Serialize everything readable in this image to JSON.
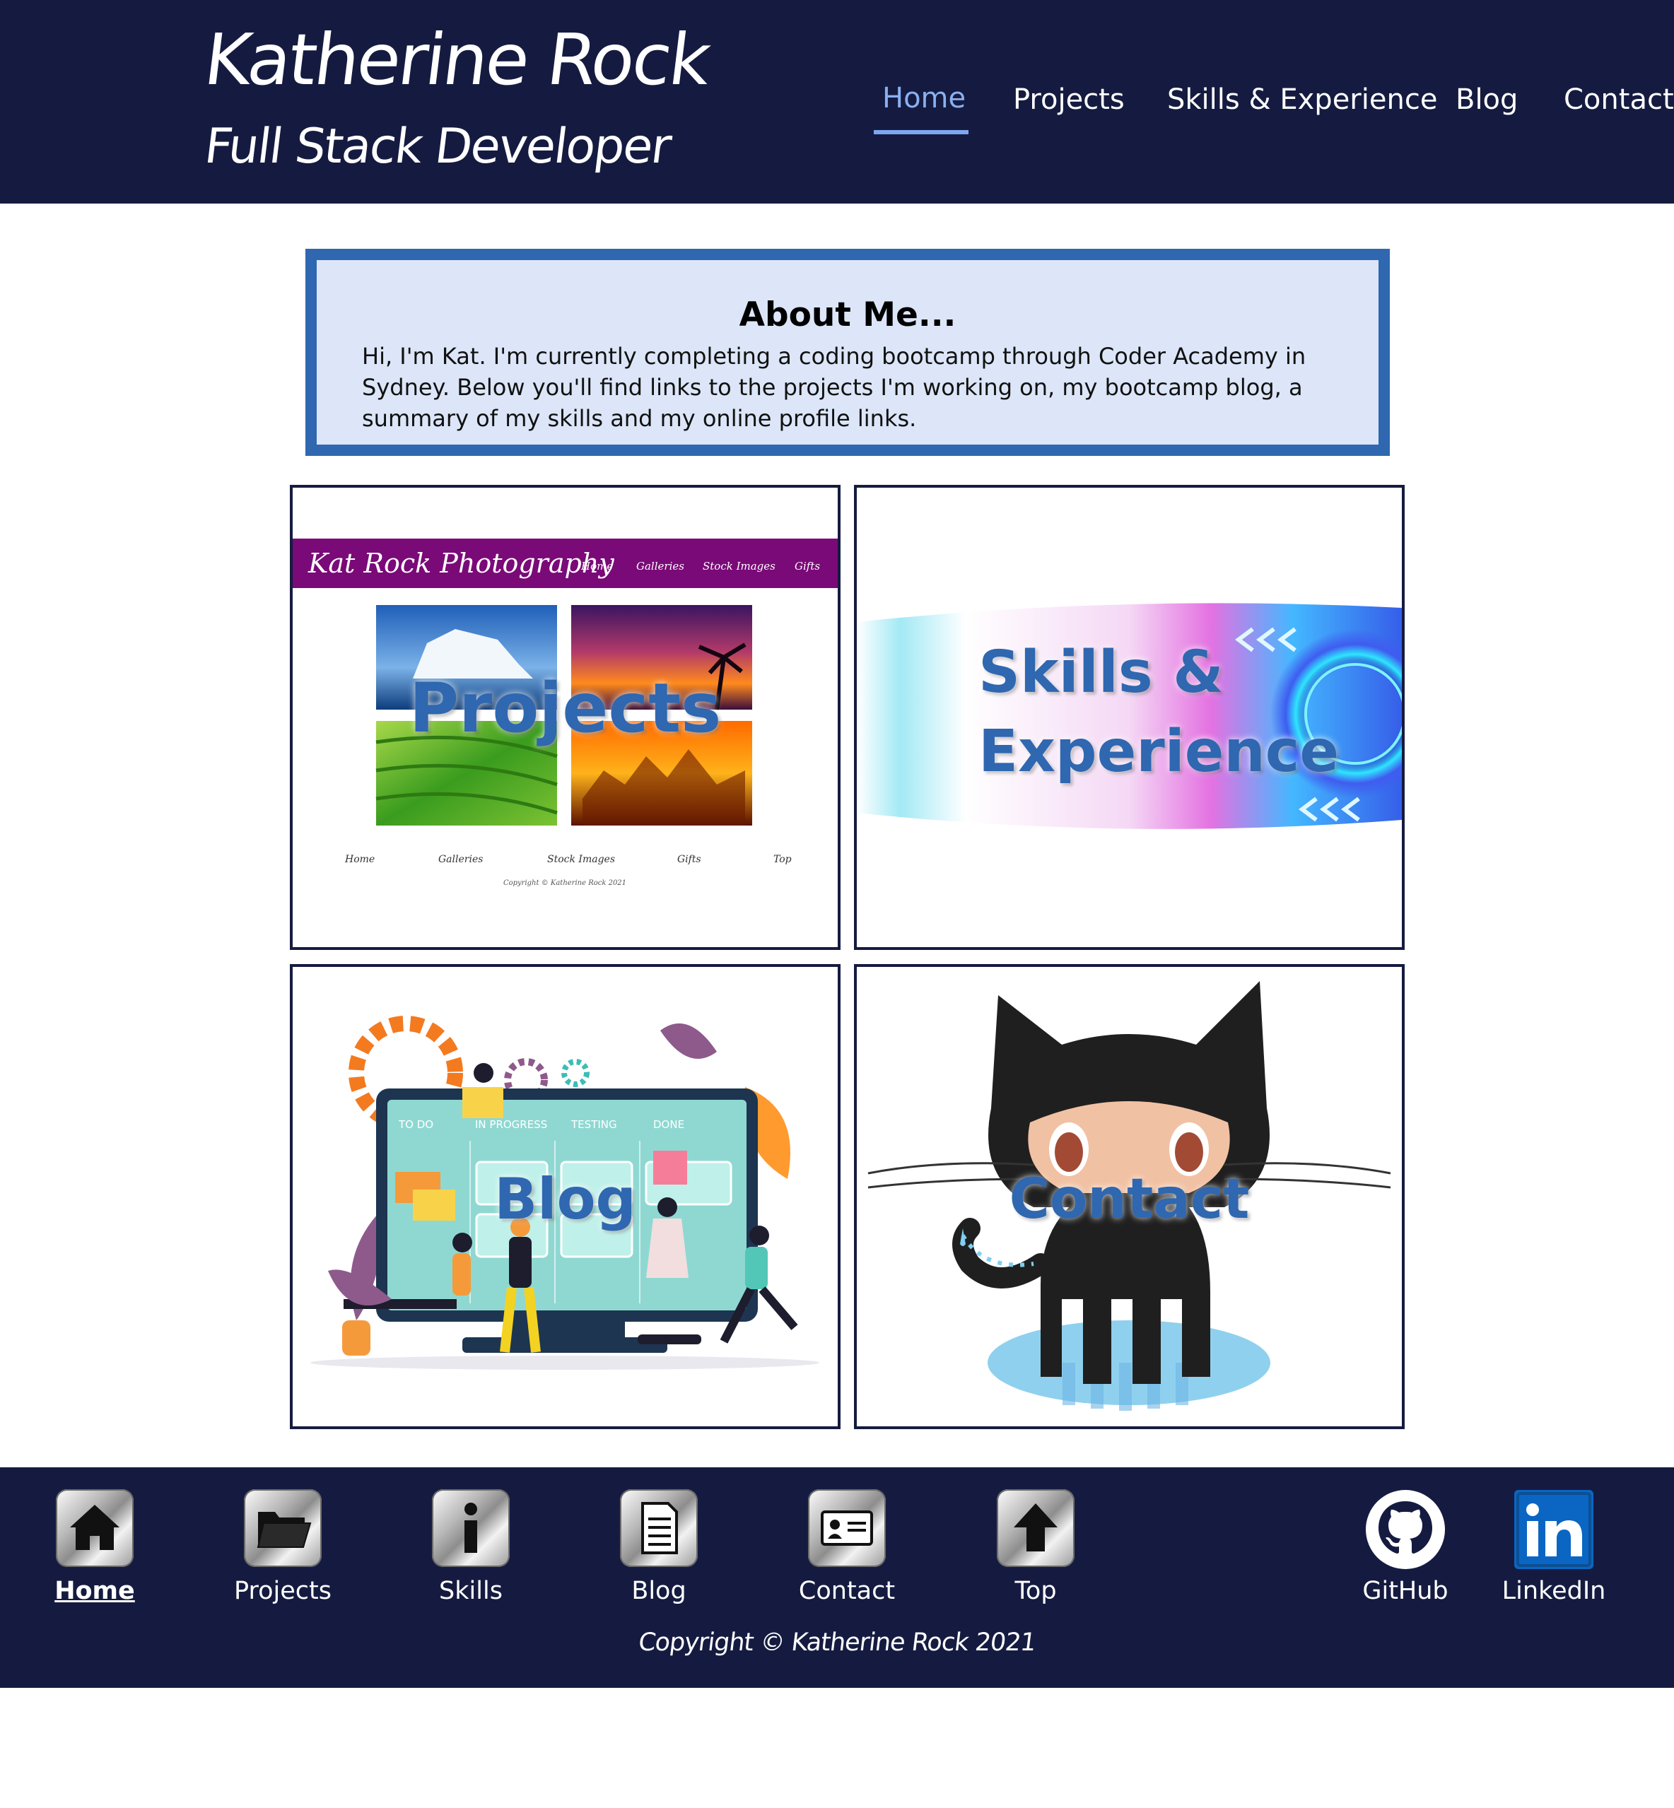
{
  "header": {
    "name": "Katherine Rock",
    "role": "Full Stack Developer",
    "nav": [
      {
        "label": "Home",
        "active": true
      },
      {
        "label": "Projects"
      },
      {
        "label": "Skills & Experience"
      },
      {
        "label": "Blog"
      },
      {
        "label": "Contact"
      }
    ]
  },
  "about": {
    "title": "About Me...",
    "body": "Hi, I'm Kat. I'm currently completing a coding bootcamp through Coder Academy in Sydney. Below you'll find links to the projects I'm working on, my bootcamp blog, a summary of my skills and my online profile links."
  },
  "cards": {
    "projects": {
      "label": "Projects",
      "preview": {
        "site_title": "Kat Rock Photography",
        "nav": [
          "Home",
          "Galleries",
          "Stock Images",
          "Gifts"
        ],
        "footer_nav": [
          "Home",
          "Galleries",
          "Stock Images",
          "Gifts",
          "Top"
        ],
        "copyright": "Copyright © Katherine Rock 2021"
      }
    },
    "skills": {
      "label_line1": "Skills &",
      "label_line2": "Experience"
    },
    "blog": {
      "label": "Blog",
      "board_columns": [
        "TO DO",
        "IN PROGRESS",
        "TESTING",
        "DONE"
      ]
    },
    "contact": {
      "label": "Contact"
    }
  },
  "footer": {
    "links": [
      {
        "label": "Home",
        "icon": "home-icon",
        "active": true
      },
      {
        "label": "Projects",
        "icon": "folder-icon"
      },
      {
        "label": "Skills",
        "icon": "info-icon"
      },
      {
        "label": "Blog",
        "icon": "document-icon"
      },
      {
        "label": "Contact",
        "icon": "contact-card-icon"
      },
      {
        "label": "Top",
        "icon": "arrow-up-icon"
      }
    ],
    "social": [
      {
        "label": "GitHub",
        "icon": "github-icon"
      },
      {
        "label": "LinkedIn",
        "icon": "linkedin-icon"
      }
    ],
    "copyright": "Copyright © Katherine Rock 2021"
  },
  "colors": {
    "navy": "#151b40",
    "accent_blue": "#2f67b0",
    "about_bg": "#dce6f8",
    "active_nav": "#8ab0f0",
    "linkedin": "#0a66c2",
    "photo_site_purple": "#7a0a78"
  }
}
